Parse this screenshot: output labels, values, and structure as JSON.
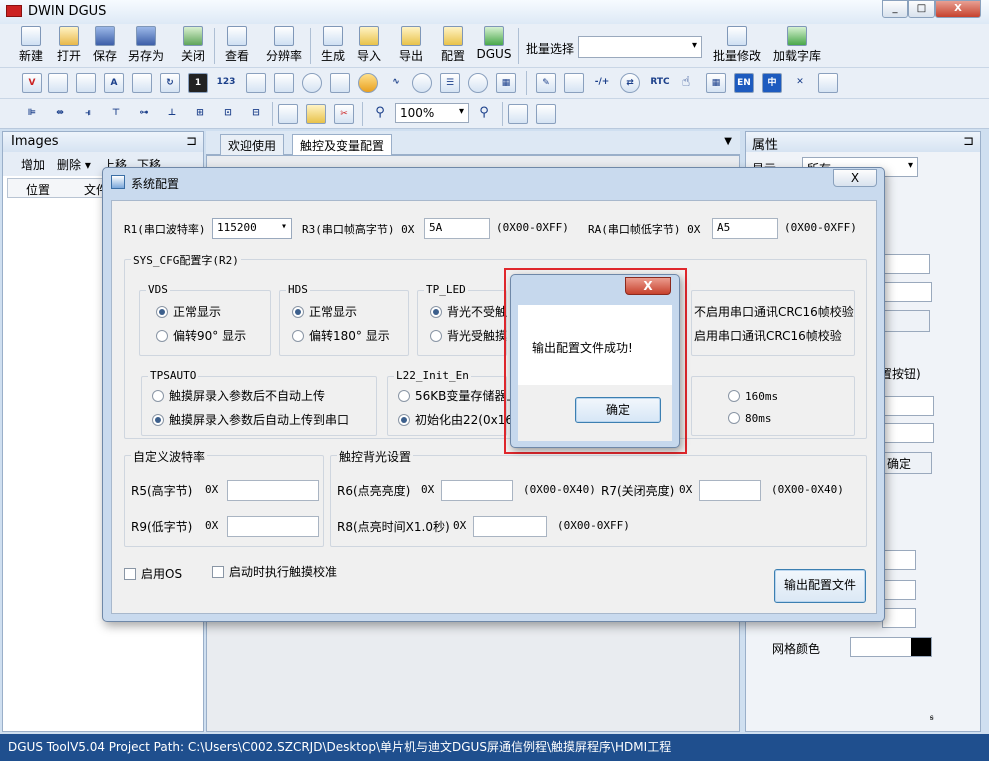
{
  "window": {
    "title": "DWIN DGUS",
    "minimize": "_",
    "maximize": "□",
    "close": "X"
  },
  "toolbar": {
    "new": "新建",
    "open": "打开",
    "save": "保存",
    "save_as": "另存为",
    "close": "关闭",
    "view": "查看",
    "resolution": "分辨率",
    "generate": "生成",
    "import": "导入",
    "export": "导出",
    "config": "配置",
    "dgus": "DGUS",
    "batch_select_label": "批量选择",
    "batch_select_value": "",
    "batch_modify": "批量修改",
    "load_font": "加载字库"
  },
  "toolbar2": {
    "num": "123",
    "rtc": "RTC",
    "en": "EN",
    "zh": "中",
    "link": "-/+"
  },
  "toolbar3": {
    "zoom": "100%"
  },
  "left_panel": {
    "title": "Images",
    "pin": "⊐",
    "add": "增加",
    "delete": "删除 ▾",
    "move_up": "上移",
    "move_down": "下移",
    "col_position": "位置",
    "col_file": "文件"
  },
  "tabs": {
    "welcome": "欢迎使用",
    "config": "触控及变量配置",
    "drop": "▼"
  },
  "right_panel": {
    "title": "属性",
    "pin": "⊐",
    "show_label": "显示",
    "show_value": "所有",
    "button_label_partial": "置按钮)",
    "confirm_partial": "确定",
    "grid_color": "网格颜色",
    "corner": "ꭶ"
  },
  "status": {
    "text": "DGUS ToolV5.04  Project Path: C:\\Users\\C002.SZCRJD\\Desktop\\单片机与迪文DGUS屏通信例程\\触摸屏程序\\HDMI工程"
  },
  "sys_dialog": {
    "title": "系统配置",
    "close": "X",
    "r1_label": "R1(串口波特率)",
    "r1_value": "115200",
    "r3_label": "R3(串口帧高字节) 0X",
    "r3_value": "5A",
    "r3_range": "(0X00-0XFF)",
    "ra_label": "RA(串口帧低字节) 0X",
    "ra_value": "A5",
    "ra_range": "(0X00-0XFF)",
    "cfg_group": "SYS_CFG配置字(R2)",
    "vds": {
      "title": "VDS",
      "opt1": "正常显示",
      "opt2": "偏转90° 显示"
    },
    "hds": {
      "title": "HDS",
      "opt1": "正常显示",
      "opt2": "偏转180° 显示"
    },
    "tp_led": {
      "title": "TP_LED",
      "opt1": "背光不受触",
      "opt2": "背光受触摸"
    },
    "crc": {
      "opt1": "不启用串口通讯CRC16帧校验",
      "opt2": "启用串口通讯CRC16帧校验"
    },
    "tpsauto": {
      "title": "TPSAUTO",
      "opt1": "触摸屏录入参数后不自动上传",
      "opt2": "触摸屏录入参数后自动上传到串口"
    },
    "l22": {
      "title": "L22_Init_En",
      "opt1": "56KB变量存储器上电",
      "opt2": "初始化由22(0x16)字"
    },
    "timing": {
      "opt1": "160ms",
      "opt2": "80ms"
    },
    "custom_baud": {
      "title": "自定义波特率",
      "r5_label": "R5(高字节)",
      "r5_prefix": "0X",
      "r5_value": "",
      "r9_label": "R9(低字节)",
      "r9_prefix": "0X",
      "r9_value": ""
    },
    "backlight": {
      "title": "触控背光设置",
      "r6_label": "R6(点亮亮度)",
      "r6_prefix": "0X",
      "r6_value": "",
      "r6_range": "(0X00-0X40)",
      "r7_label": "R7(关闭亮度)",
      "r7_prefix": "0X",
      "r7_value": "",
      "r7_range": "(0X00-0X40)",
      "r8_label": "R8(点亮时间X1.0秒)",
      "r8_prefix": "0X",
      "r8_value": "",
      "r8_range": "(0X00-0XFF)"
    },
    "enable_os": "启用OS",
    "calibrate": "启动时执行触摸校准",
    "export_btn": "输出配置文件"
  },
  "message_box": {
    "close": "X",
    "text": "输出配置文件成功!",
    "ok": "确定"
  },
  "colors": {
    "status_bar": "#1f4f8e",
    "highlight": "#e0272c",
    "dialog_frame": "#c9daee"
  }
}
